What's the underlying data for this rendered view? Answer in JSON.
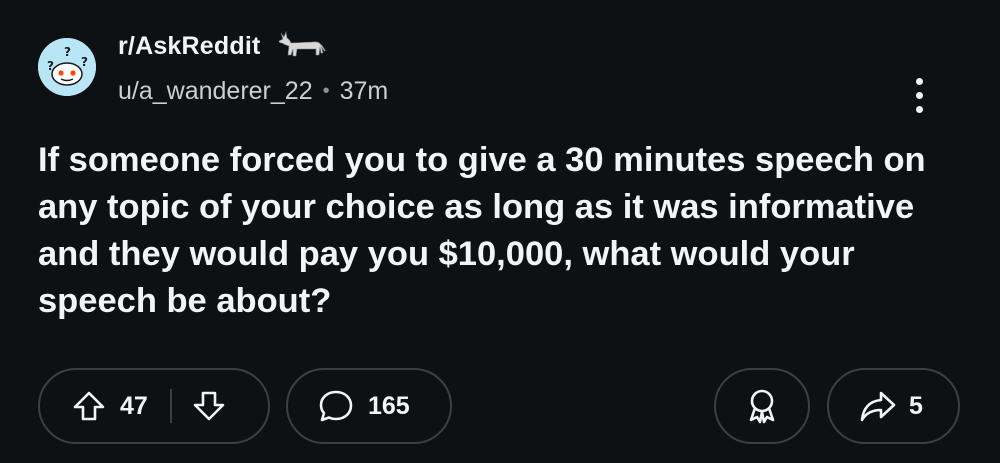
{
  "post": {
    "subreddit": "r/AskReddit",
    "author": "u/a_wanderer_22",
    "separator": "•",
    "time": "37m",
    "title": "If someone forced you to give a 30 minutes speech on any topic of your choice as long as it was informative and they would pay you $10,000, what would your speech be about?"
  },
  "actions": {
    "upvotes": "47",
    "comments": "165",
    "shares": "5"
  },
  "icons": {
    "avatar": "askreddit-snoo-icon",
    "flair": "donkey-icon",
    "menu": "more-vertical-icon",
    "upvote": "upvote-arrow-icon",
    "downvote": "downvote-arrow-icon",
    "comment": "comment-bubble-icon",
    "award": "award-icon",
    "share": "share-arrow-icon"
  },
  "colors": {
    "background": "#0e1113",
    "text": "#f2f4f5",
    "border": "#3a4145",
    "avatar_bg": "#b9e6f7"
  }
}
